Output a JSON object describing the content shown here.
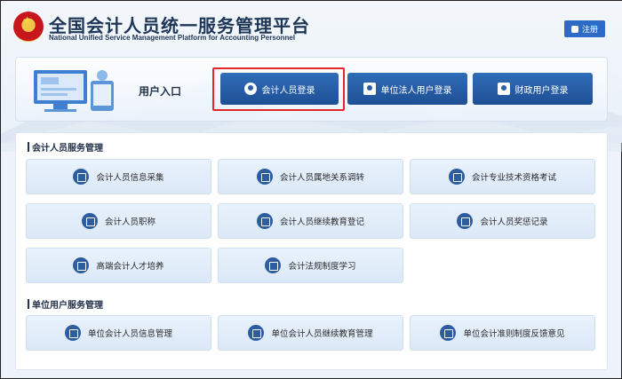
{
  "header": {
    "title": "全国会计人员统一服务管理平台",
    "subtitle": "National Unified Service Management Platform for Accounting Personnel",
    "register_label": "注册"
  },
  "login": {
    "entry_label": "用户入口",
    "buttons": [
      {
        "label": "会计人员登录",
        "icon": "user-icon"
      },
      {
        "label": "单位法人用户登录",
        "icon": "building-icon"
      },
      {
        "label": "财政用户登录",
        "icon": "id-card-icon"
      }
    ]
  },
  "accountant_section": {
    "title": "会计人员服务管理",
    "items": [
      {
        "label": "会计人员信息采集",
        "icon": "form-edit-icon"
      },
      {
        "label": "会计人员属地关系调转",
        "icon": "transfer-icon"
      },
      {
        "label": "会计专业技术资格考试",
        "icon": "exam-icon"
      },
      {
        "label": "会计人员职称",
        "icon": "title-icon"
      },
      {
        "label": "会计人员继续教育登记",
        "icon": "education-icon"
      },
      {
        "label": "会计人员奖惩记录",
        "icon": "record-icon"
      },
      {
        "label": "高端会计人才培养",
        "icon": "graduation-cap-icon"
      },
      {
        "label": "会计法规制度学习",
        "icon": "play-icon"
      }
    ]
  },
  "unit_section": {
    "title": "单位用户服务管理",
    "items": [
      {
        "label": "单位会计人员信息管理",
        "icon": "id-card-icon"
      },
      {
        "label": "单位会计人员继续教育管理",
        "icon": "education-icon"
      },
      {
        "label": "单位会计准则制度反馈意见",
        "icon": "feedback-icon"
      }
    ]
  },
  "colors": {
    "primary": "#2d6cc6",
    "login_button": "#1f4f94",
    "tile_bg": "#e3eefa",
    "highlight": "#e3262c"
  }
}
